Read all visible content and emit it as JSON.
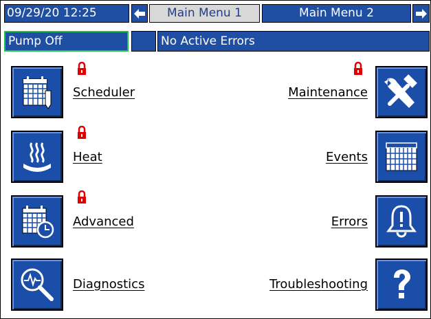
{
  "header": {
    "datetime": "09/29/20 12:25",
    "tab_left_arrow": "←",
    "tab1_label": "Main Menu 1",
    "tab2_label": "Main Menu 2",
    "tab_right_arrow": "→"
  },
  "status": {
    "pump": "Pump Off",
    "errors": "No Active Errors"
  },
  "menu": {
    "scheduler": "Scheduler",
    "heat": "Heat",
    "advanced": "Advanced",
    "diagnostics": "Diagnostics",
    "maintenance": "Maintenance",
    "events": "Events",
    "errors": "Errors",
    "troubleshooting": "Troubleshooting"
  },
  "icons": {
    "scheduler": "calendar-pencil-icon",
    "heat": "heat-icon",
    "advanced": "calendar-clock-icon",
    "diagnostics": "magnifier-waveform-icon",
    "maintenance": "wrench-hammer-icon",
    "events": "calendar-grid-icon",
    "errors": "bell-alert-icon",
    "troubleshooting": "question-icon",
    "lock": "lock-icon"
  },
  "colors": {
    "accent_blue": "#1f4fa3",
    "tab_grey": "#d8d8d8",
    "lock_red": "#e00000",
    "pump_border": "#22c04a"
  }
}
